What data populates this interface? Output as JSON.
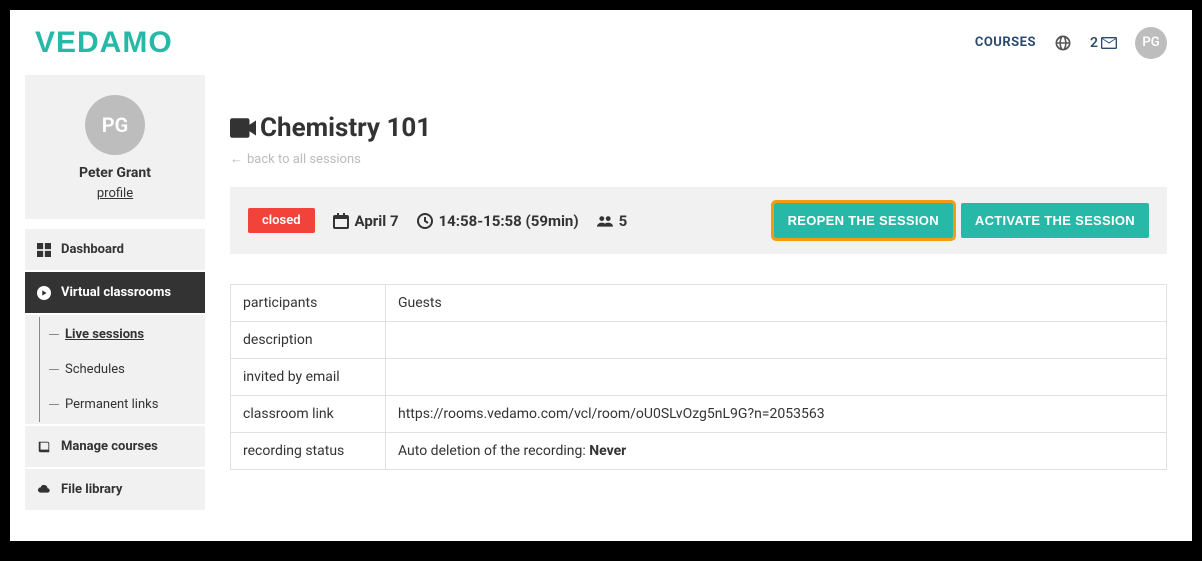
{
  "brand": "VEDAMO",
  "header": {
    "courses_label": "COURSES",
    "notif_count": "2",
    "avatar_initials": "PG"
  },
  "sidebar": {
    "avatar_initials": "PG",
    "user_name": "Peter Grant",
    "profile_link": "profile",
    "nav": {
      "dashboard": "Dashboard",
      "virtual_classrooms": "Virtual classrooms",
      "live_sessions": "Live sessions",
      "schedules": "Schedules",
      "permanent_links": "Permanent links",
      "manage_courses": "Manage courses",
      "file_library": "File library"
    }
  },
  "page": {
    "title": "Chemistry 101",
    "back_link": "back to all sessions",
    "status_badge": "closed",
    "date": "April 7",
    "time": "14:58-15:58 (59min)",
    "participants_count": "5",
    "reopen_button": "REOPEN THE SESSION",
    "activate_button": "ACTIVATE THE SESSION",
    "details": {
      "participants_label": "participants",
      "participants_value": "Guests",
      "description_label": "description",
      "description_value": "",
      "invited_label": "invited by email",
      "invited_value": "",
      "classroom_link_label": "classroom link",
      "classroom_link_value": "https://rooms.vedamo.com/vcl/room/oU0SLvOzg5nL9G?n=2053563",
      "recording_label": "recording status",
      "recording_prefix": "Auto deletion of the recording: ",
      "recording_value": "Never"
    }
  }
}
